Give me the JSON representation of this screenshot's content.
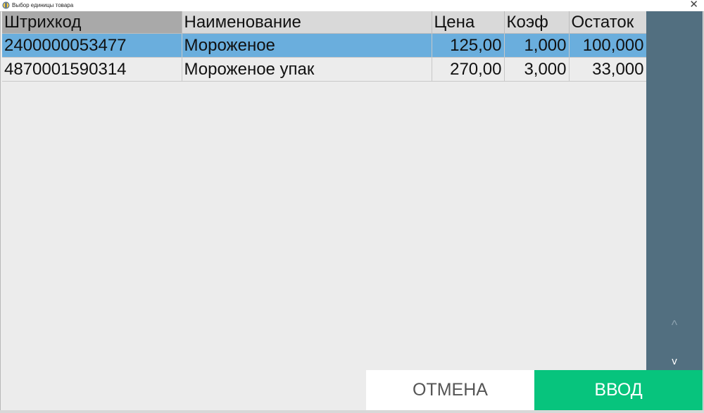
{
  "window": {
    "title": "Выбор единицы товара",
    "close_label": "✕"
  },
  "table": {
    "columns": [
      "Штрихкод",
      "Наименование",
      "Цена",
      "Коэф",
      "Остаток"
    ],
    "rows": [
      {
        "barcode": "2400000053477",
        "name": "Мороженое",
        "price": "125,00",
        "coef": "1,000",
        "stock": "100,000",
        "selected": true
      },
      {
        "barcode": "4870001590314",
        "name": "Мороженое упак",
        "price": "270,00",
        "coef": "3,000",
        "stock": "33,000",
        "selected": false
      }
    ]
  },
  "scroll": {
    "up_label": "^",
    "down_label": "v"
  },
  "buttons": {
    "cancel_label": "ОТМЕНА",
    "enter_label": "ВВОД"
  },
  "colors": {
    "selected_row": "#6aaedd",
    "scroll_panel": "#526f80",
    "enter_button": "#07c47d"
  }
}
